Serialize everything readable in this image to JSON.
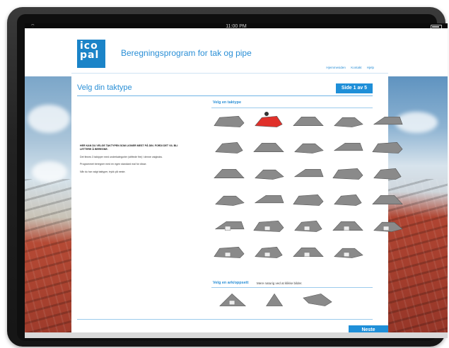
{
  "statusbar": {
    "time": "11:00 PM",
    "wifi": "⌔"
  },
  "header": {
    "logo_text": "ico pal",
    "app_title": "Beregningsprogram for tak og pipe",
    "links": [
      "Hjemmesiden",
      "Kontakt",
      "Hjelp"
    ]
  },
  "page": {
    "title": "Velg din taktype",
    "badge": "Side 1 av 5"
  },
  "sections": {
    "roof_type": "Velg en taktype",
    "wall_type": "Velg en ark/oppsett",
    "wall_note": "Mere naturig ved at klikke bilder."
  },
  "intro": {
    "bold": "HER KAN DU VELGE TAKTYPEN SOM LIGNER MEST PÅ DIN. FORDI DET VIL BLI LETTERE Å BEREGNE.",
    "p1": "Det finnes 3 taktyper med underkategorier (stiftede fire) i denne valgboks.",
    "p2": "Programmet beregner med en egen standard mal for disse.",
    "p3": "Når du har valgt taktyper, trykk på neste."
  },
  "roofs": {
    "rows": 6,
    "cols": 5,
    "selected_index": 1,
    "count": 29,
    "wall_count": 3
  },
  "colors": {
    "accent": "#1f8fd8",
    "roof_gray": "#8a8a8a",
    "roof_selected": "#e0302a"
  },
  "buttons": {
    "next": "Neste"
  }
}
